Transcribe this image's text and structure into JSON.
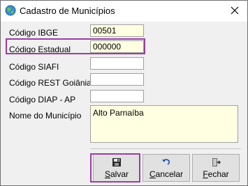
{
  "window": {
    "title": "Cadastro de Municípios"
  },
  "fields": {
    "codigo_ibge": {
      "label": "Código IBGE",
      "value": "00501"
    },
    "codigo_estadual": {
      "label": "Código Estadual",
      "value": "000000"
    },
    "codigo_siafi": {
      "label": "Código SIAFI",
      "value": ""
    },
    "codigo_rest_goiania": {
      "label": "Código REST Goiânia",
      "value": ""
    },
    "codigo_diap_ap": {
      "label": "Código DIAP - AP",
      "value": ""
    },
    "nome_municipio": {
      "label": "Nome do Município",
      "value": "Alto Parnaíba"
    }
  },
  "buttons": {
    "salvar": {
      "accel": "S",
      "rest": "alvar"
    },
    "cancelar": {
      "accel": "C",
      "rest": "ancelar"
    },
    "fechar": {
      "accel": "F",
      "rest": "echar"
    }
  },
  "icons": {
    "app": "globe-icon",
    "close": "close-icon",
    "save": "floppy-disk-icon",
    "cancel": "undo-arrow-icon",
    "exit": "exit-door-icon"
  },
  "colors": {
    "highlight": "#9b3da4",
    "input_active": "#ffffe1"
  }
}
